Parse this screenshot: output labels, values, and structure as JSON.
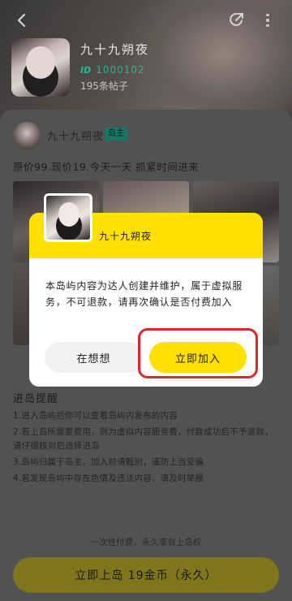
{
  "header": {
    "profile_name": "九十九朔夜",
    "id_tag": "ID",
    "id_value": "1000102",
    "posts_count": "195条帖子",
    "icons": [
      "back-icon",
      "share-icon",
      "more-icon"
    ]
  },
  "post": {
    "author": "九十九朔夜",
    "owner_badge": "岛主",
    "title": "原价99.现价19.今天一天 抓紧时间进来"
  },
  "notice": {
    "title": "进岛提醒",
    "items": [
      "1.进入岛屿后你可以查看岛屿内发布的内容",
      "2.若上岛所需要费用，则为虚拟内容服务费，付款成功后不予退款，请仔细核对后选择进岛",
      "3.岛屿归属于岛主，加入前请甄别，谨防上当受骗",
      "4.若发现岛屿中存在色情及违法内容，请及时举报"
    ]
  },
  "footer": {
    "note": "一次性付费，永久享有上岛权",
    "join_button": "立即上岛 19金币（永久）"
  },
  "dialog": {
    "name": "九十九朔夜",
    "message": "本岛屿内容为达人创建并维护，属于虚拟服务，不可退款，请再次确认是否付费加入",
    "cancel_label": "在想想",
    "confirm_label": "立即加入",
    "highlight_color": "#e02626",
    "accent_color": "#ffe000"
  }
}
